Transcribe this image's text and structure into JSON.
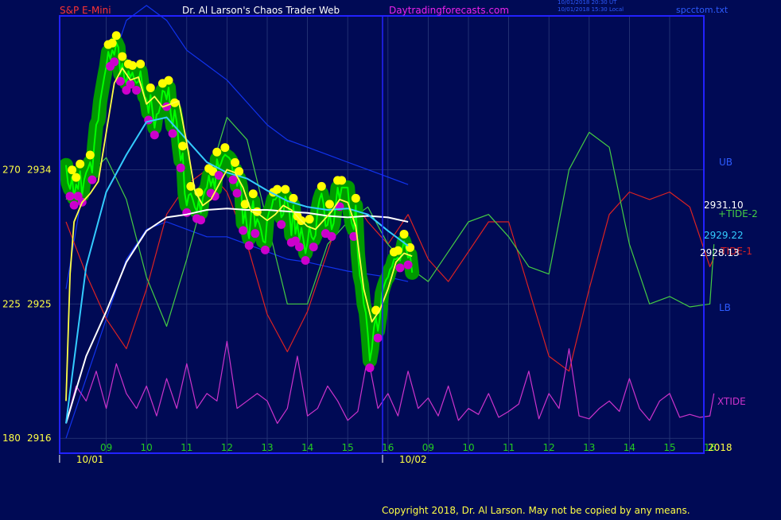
{
  "header": {
    "instrument": "S&P E-Mini",
    "site": "Dr. Al Larson's Chaos Trader Web",
    "url": "Daytradingforecasts.com",
    "time_ut": "10/01/2018 20:30 UT",
    "time_local": "10/01/2018 15:30 Local",
    "file": "spcctom.txt"
  },
  "footer": {
    "copyright": "Copyright 2018, Dr. Al Larson. May not be copied by any means."
  },
  "colors": {
    "background": "#000a55",
    "frame": "#2222ff",
    "price": "#00ff00",
    "price_band": "#009900",
    "high_dot": "#ffff00",
    "low_dot": "#cc00cc",
    "fast_ma": "#ffff44",
    "mid_ma": "#33ccff",
    "slow_ma": "#ffffff",
    "tide_plus2": "#44cc44",
    "tide_minus1": "#dd2222",
    "xtide": "#cc33cc",
    "bands": "#1133ee"
  },
  "chart_data": {
    "type": "line",
    "y_axis": {
      "ticks": [
        {
          "tide": "270",
          "price": "2934",
          "value": 2934
        },
        {
          "tide": "225",
          "price": "2925",
          "value": 2925
        },
        {
          "tide": "180",
          "price": "2916",
          "value": 2916
        }
      ],
      "ylim": [
        2915,
        2944.3
      ]
    },
    "x_axis": {
      "hour_labels": [
        "09",
        "10",
        "11",
        "12",
        "13",
        "14",
        "15",
        "16",
        "09",
        "10",
        "11",
        "12",
        "13",
        "14",
        "15",
        "16"
      ],
      "date_labels": [
        "10/01",
        "10/02"
      ],
      "year_label": "2018"
    },
    "right_labels": {
      "ub": "UB",
      "lb": "LB",
      "tide_plus2": "+TIDE-2",
      "tide_minus1": "-TIDE-1",
      "xtide": "XTIDE",
      "last_high": "2931.10",
      "last_mid": "2929.22",
      "last_low": "2928.13"
    },
    "series": [
      {
        "key": "price",
        "x": [
          0,
          0.05,
          0.1,
          0.15,
          0.2,
          0.25,
          0.3,
          0.35,
          0.4,
          0.45,
          0.5,
          0.55,
          0.6,
          0.65,
          0.7,
          0.75,
          0.8,
          0.85,
          0.9,
          0.95,
          1,
          1.05,
          1.1,
          1.15,
          1.2,
          1.25,
          1.3,
          1.35,
          1.4,
          1.45,
          1.5,
          1.55,
          1.6,
          1.65,
          1.7,
          1.75,
          1.8,
          1.85,
          1.9,
          1.95,
          2,
          2.05,
          2.1,
          2.15,
          2.2,
          2.25,
          2.3,
          2.35,
          2.4,
          2.45,
          2.5,
          2.55,
          2.6,
          2.65,
          2.7,
          2.75,
          2.8,
          2.85,
          2.9,
          2.95,
          3,
          3.05,
          3.1,
          3.15,
          3.2,
          3.25,
          3.3,
          3.35,
          3.4,
          3.45,
          3.5,
          3.55,
          3.6,
          3.65,
          3.7,
          3.75,
          3.8,
          3.85,
          3.9,
          3.95,
          4,
          4.05,
          4.1,
          4.15,
          4.2,
          4.25,
          4.3,
          4.35,
          4.4,
          4.45,
          4.5,
          4.55,
          4.6,
          4.65,
          4.7,
          4.75,
          4.8,
          4.85,
          4.9,
          4.95,
          5,
          5.05,
          5.1,
          5.15,
          5.2,
          5.25,
          5.3,
          5.35,
          5.4,
          5.45,
          5.5,
          5.55,
          5.6,
          5.65,
          5.7,
          5.75,
          5.8,
          5.85,
          5.9,
          5.95,
          6,
          6.05,
          6.1,
          6.15,
          6.2,
          6.25,
          6.3,
          6.35,
          6.4,
          6.45,
          6.5,
          6.55,
          6.6,
          6.65,
          6.7,
          6.75,
          6.8,
          6.85,
          6.9,
          6.95,
          7,
          7.05,
          7.1,
          7.15,
          7.2,
          7.25,
          7.3,
          7.35,
          7.4,
          7.45,
          7.5,
          7.55,
          7.6,
          7.65,
          7.7,
          7.75,
          7.8,
          7.85,
          7.9,
          7.95,
          8,
          8.05,
          8.1,
          8.15,
          8.2,
          8.25,
          8.3,
          8.35,
          8.4,
          8.45,
          8.5,
          8.55,
          8.6
        ],
        "y": [
          2934.3,
          2933.1,
          2932.7,
          2933.5,
          2932.1,
          2933.0,
          2932.7,
          2933.9,
          2932.3,
          2933.3,
          2933.8,
          2934.1,
          2934.5,
          2933.8,
          2935.6,
          2937.0,
          2937.3,
          2938.6,
          2939.4,
          2940.2,
          2940.9,
          2941.9,
          2941.4,
          2942.0,
          2941.7,
          2942.5,
          2942.2,
          2940.4,
          2941.1,
          2940.1,
          2939.8,
          2940.6,
          2940.2,
          2940.5,
          2940.0,
          2939.8,
          2939.9,
          2940.6,
          2939.6,
          2938.9,
          2938.7,
          2937.8,
          2939.0,
          2937.9,
          2936.8,
          2937.7,
          2937.8,
          2938.3,
          2939.3,
          2939.2,
          2938.7,
          2939.5,
          2937.8,
          2936.9,
          2938.0,
          2937.2,
          2935.7,
          2934.6,
          2935.1,
          2932.4,
          2931.6,
          2932.3,
          2932.4,
          2932.0,
          2931.5,
          2931.2,
          2932.0,
          2931.1,
          2932.1,
          2932.6,
          2932.8,
          2933.6,
          2932.9,
          2933.4,
          2932.7,
          2934.7,
          2934.1,
          2934.4,
          2934.8,
          2935.0,
          2934.9,
          2934.8,
          2934.6,
          2933.8,
          2934.0,
          2932.9,
          2933.4,
          2932.8,
          2930.4,
          2931.2,
          2930.1,
          2929.4,
          2931.1,
          2931.9,
          2930.2,
          2930.7,
          2930.4,
          2929.9,
          2929.2,
          2929.1,
          2930.7,
          2931.2,
          2931.4,
          2932.0,
          2932.0,
          2932.2,
          2932.2,
          2930.8,
          2931.0,
          2932.2,
          2931.8,
          2931.2,
          2929.6,
          2931.6,
          2929.7,
          2930.4,
          2929.3,
          2930.1,
          2929.3,
          2928.4,
          2929.1,
          2930.2,
          2929.5,
          2929.3,
          2929.6,
          2931.3,
          2932.0,
          2932.4,
          2931.7,
          2930.2,
          2930.3,
          2931.2,
          2930.0,
          2930.4,
          2931.6,
          2932.8,
          2932.0,
          2932.8,
          2932.8,
          2932.8,
          2932.8,
          2931.2,
          2930.4,
          2930.0,
          2931.6,
          2928.4,
          2926.9,
          2926.3,
          2925.0,
          2924.4,
          2923.0,
          2921.2,
          2922.0,
          2923.4,
          2924.1,
          2923.2,
          2924.1,
          2925.7,
          2926.2,
          2926.6,
          2926.8,
          2927.3,
          2927.5,
          2928.0,
          2928.0,
          2928.1,
          2927.9,
          2928.6,
          2929.2,
          2928.7,
          2928.1,
          2928.3,
          2927.1
        ]
      },
      {
        "key": "fast_ma",
        "x": [
          0,
          0.1,
          0.2,
          0.4,
          0.6,
          0.8,
          1,
          1.2,
          1.4,
          1.6,
          1.8,
          2,
          2.2,
          2.4,
          2.6,
          2.8,
          3,
          3.2,
          3.4,
          3.6,
          3.8,
          4,
          4.2,
          4.4,
          4.6,
          4.8,
          5,
          5.2,
          5.4,
          5.6,
          5.8,
          6,
          6.2,
          6.4,
          6.6,
          6.8,
          7,
          7.2,
          7.4,
          7.6,
          7.8,
          8,
          8.2,
          8.4,
          8.6
        ],
        "y": [
          2918.5,
          2927.0,
          2930.5,
          2931.8,
          2932.4,
          2933.2,
          2936.5,
          2939.8,
          2940.8,
          2940.0,
          2940.2,
          2938.4,
          2938.9,
          2938.2,
          2938.4,
          2938.6,
          2935.8,
          2932.6,
          2931.6,
          2932.0,
          2933.0,
          2934.0,
          2933.8,
          2932.8,
          2931.2,
          2931.0,
          2930.6,
          2931.0,
          2931.6,
          2931.3,
          2930.7,
          2930.2,
          2930.0,
          2930.6,
          2931.2,
          2932.0,
          2931.8,
          2930.2,
          2926.0,
          2923.8,
          2924.6,
          2926.0,
          2927.8,
          2928.4,
          2928.2
        ]
      },
      {
        "key": "mid_ma",
        "x": [
          0,
          0.5,
          1,
          1.5,
          2,
          2.5,
          3,
          3.5,
          4,
          4.5,
          5,
          5.5,
          6,
          6.5,
          7,
          7.5,
          8,
          8.5
        ],
        "y": [
          2917.0,
          2927.5,
          2932.5,
          2935.0,
          2937.2,
          2937.5,
          2936.0,
          2934.5,
          2933.8,
          2933.4,
          2932.6,
          2931.9,
          2931.5,
          2931.3,
          2931.4,
          2931.0,
          2929.9,
          2928.9
        ]
      },
      {
        "key": "slow_ma",
        "x": [
          0,
          0.5,
          1,
          1.5,
          2,
          2.5,
          3,
          3.5,
          4,
          4.5,
          5,
          5.5,
          6,
          6.5,
          7,
          7.5,
          8,
          8.5
        ],
        "y": [
          2917.0,
          2921.5,
          2924.5,
          2927.8,
          2929.9,
          2930.8,
          2931.0,
          2931.3,
          2931.4,
          2931.3,
          2931.3,
          2931.2,
          2931.1,
          2930.9,
          2930.8,
          2930.9,
          2930.8,
          2930.5
        ]
      },
      {
        "key": "band_upper",
        "x": [
          0,
          0.5,
          1,
          1.5,
          2,
          2.5,
          3,
          3.5,
          4,
          4.5,
          5,
          5.5,
          6,
          6.5,
          7,
          7.5,
          8,
          8.5
        ],
        "y": [
          2926,
          2934,
          2940,
          2944,
          2945,
          2944,
          2942,
          2941,
          2940,
          2938.5,
          2937,
          2936,
          2935.5,
          2935,
          2934.5,
          2934,
          2933.5,
          2933
        ]
      },
      {
        "key": "band_lower",
        "x": [
          0,
          0.5,
          1,
          1.5,
          2,
          2.5,
          3,
          3.5,
          4,
          4.5,
          5,
          5.5,
          6,
          6.5,
          7,
          7.5,
          8,
          8.5
        ],
        "y": [
          2916,
          2920,
          2924,
          2928,
          2930,
          2930.5,
          2930,
          2929.5,
          2929.5,
          2929,
          2928.5,
          2928,
          2927.8,
          2927.5,
          2927.2,
          2927,
          2926.8,
          2926.5
        ]
      },
      {
        "key": "tide_plus2",
        "x": [
          0,
          0.5,
          1,
          1.5,
          2,
          2.5,
          3,
          3.5,
          4,
          4.5,
          5,
          5.5,
          6,
          6.5,
          7,
          7.5,
          8,
          8.5,
          9,
          9.5,
          10,
          10.5,
          11,
          11.5,
          12,
          12.5,
          13,
          13.5,
          14,
          14.5,
          15,
          15.5,
          16,
          16.1
        ],
        "y": [
          2932,
          2933.5,
          2934.8,
          2932,
          2926.8,
          2923.5,
          2928,
          2933,
          2937.5,
          2936,
          2930.5,
          2925,
          2925,
          2929,
          2930.5,
          2931.5,
          2929,
          2927.5,
          2926.5,
          2928.5,
          2930.5,
          2931,
          2929.5,
          2927.5,
          2927,
          2934,
          2936.5,
          2935.5,
          2929,
          2925,
          2925.5,
          2924.8,
          2925,
          2929
        ]
      },
      {
        "key": "tide_minus1",
        "x": [
          0,
          0.5,
          1,
          1.5,
          2,
          2.5,
          3,
          3.5,
          4,
          4.5,
          5,
          5.5,
          6,
          6.5,
          7,
          7.5,
          8,
          8.5,
          9,
          9.5,
          10,
          10.5,
          11,
          11.5,
          12,
          12.5,
          13,
          13.5,
          14,
          14.5,
          15,
          15.5,
          16,
          16.1
        ],
        "y": [
          2930.5,
          2927,
          2924,
          2922,
          2926,
          2931,
          2933,
          2934,
          2932.5,
          2929,
          2924.3,
          2921.8,
          2924.5,
          2928.5,
          2932.5,
          2930.5,
          2929,
          2931,
          2928,
          2926.5,
          2928.5,
          2930.5,
          2930.5,
          2926,
          2921.5,
          2920.5,
          2926,
          2931,
          2932.5,
          2932,
          2932.5,
          2931.5,
          2927.5,
          2928.1
        ]
      },
      {
        "key": "xtide",
        "x": [
          0,
          0.25,
          0.5,
          0.75,
          1,
          1.25,
          1.5,
          1.75,
          2,
          2.25,
          2.5,
          2.75,
          3,
          3.25,
          3.5,
          3.75,
          4,
          4.25,
          4.5,
          4.75,
          5,
          5.25,
          5.5,
          5.75,
          6,
          6.25,
          6.5,
          6.75,
          7,
          7.25,
          7.5,
          7.75,
          8,
          8.25,
          8.5,
          8.75,
          9,
          9.25,
          9.5,
          9.75,
          10,
          10.25,
          10.5,
          10.75,
          11,
          11.25,
          11.5,
          11.75,
          12,
          12.25,
          12.5,
          12.75,
          13,
          13.25,
          13.5,
          13.75,
          14,
          14.25,
          14.5,
          14.75,
          15,
          15.25,
          15.5,
          15.75,
          16,
          16.1
        ],
        "y": [
          2917,
          2919.5,
          2918.5,
          2920.5,
          2918,
          2921,
          2919,
          2918,
          2919.5,
          2917.5,
          2920,
          2918,
          2921,
          2918,
          2919,
          2918.5,
          2922.5,
          2918,
          2918.5,
          2919,
          2918.5,
          2917,
          2918,
          2921.5,
          2917.5,
          2918,
          2919.5,
          2918.5,
          2917.2,
          2917.8,
          2921.5,
          2918,
          2919,
          2917.5,
          2920.5,
          2918,
          2918.7,
          2917.5,
          2919.5,
          2917.2,
          2918,
          2917.6,
          2919,
          2917.4,
          2917.8,
          2918.3,
          2920.5,
          2917.3,
          2919,
          2918,
          2922,
          2917.5,
          2917.3,
          2918,
          2918.5,
          2917.8,
          2920,
          2918,
          2917.2,
          2918.5,
          2919,
          2917.4,
          2917.6,
          2917.4,
          2917.5,
          2919
        ]
      }
    ]
  }
}
